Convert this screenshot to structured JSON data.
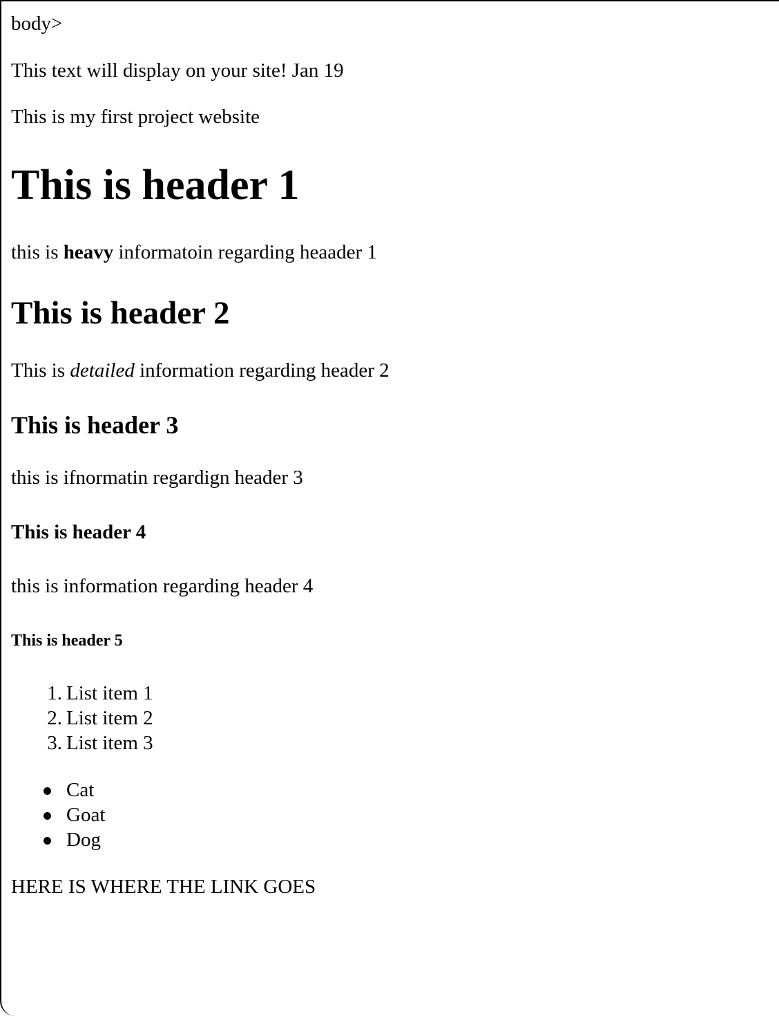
{
  "stray_text": "body>",
  "intro": {
    "display_text": "This text will display on your site! Jan 19",
    "first_project": "This is my first project website"
  },
  "sections": {
    "h1": {
      "title": "This is header 1",
      "text_before": "this is ",
      "text_bold": "heavy",
      "text_after": " informatoin regarding heaader 1"
    },
    "h2": {
      "title": "This is header 2",
      "text_before": "This is ",
      "text_italic": "detailed",
      "text_after": " information regarding header 2"
    },
    "h3": {
      "title": "This is header 3",
      "text": "this is ifnormatin regardign header 3"
    },
    "h4": {
      "title": "This is header 4",
      "text": "this is information regarding header 4"
    },
    "h5": {
      "title": "This is header 5"
    }
  },
  "ordered_list": [
    {
      "marker": "1.",
      "label": "List item 1"
    },
    {
      "marker": "2.",
      "label": "List item 2"
    },
    {
      "marker": "3.",
      "label": "List item 3"
    }
  ],
  "unordered_list": [
    {
      "label": "Cat"
    },
    {
      "label": "Goat"
    },
    {
      "label": "Dog"
    }
  ],
  "link_placeholder": "HERE IS WHERE THE LINK GOES"
}
